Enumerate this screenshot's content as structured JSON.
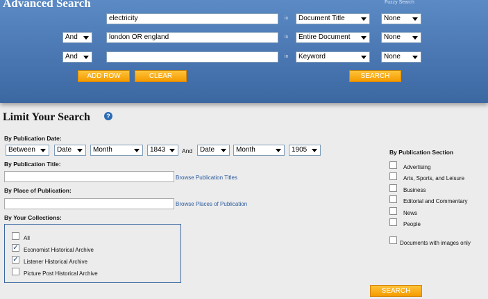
{
  "advanced_search": {
    "title": "Advanced Search",
    "fuzzy_label": "Fuzzy Search",
    "rows": [
      {
        "operator": "",
        "term": "electricity",
        "in_label": "in",
        "field": "Document Title",
        "fuzzy": "None"
      },
      {
        "operator": "And",
        "term": "london OR england",
        "in_label": "in",
        "field": "Entire Document",
        "fuzzy": "None"
      },
      {
        "operator": "And",
        "term": "",
        "in_label": "in",
        "field": "Keyword",
        "fuzzy": "None"
      }
    ],
    "add_row_label": "ADD ROW",
    "clear_label": "CLEAR",
    "search_label": "SEARCH"
  },
  "limit": {
    "title": "Limit Your Search",
    "help_icon": "?",
    "pub_date": {
      "label": "By Publication Date:",
      "mode": "Between",
      "from_unit": "Date",
      "from_month": "Month",
      "from_year": "1843",
      "and_label": "And",
      "to_unit": "Date",
      "to_month": "Month",
      "to_year": "1905"
    },
    "pub_title": {
      "label": "By Publication Title:",
      "value": "",
      "link": "Browse Publication Titles"
    },
    "pub_place": {
      "label": "By Place of Publication:",
      "value": "",
      "link": "Browse Places of Publication"
    },
    "collections": {
      "label": "By Your Collections:",
      "items": [
        {
          "label": "All",
          "checked": false
        },
        {
          "label": "Economist Historical Archive",
          "checked": true
        },
        {
          "label": "Listener Historical Archive",
          "checked": true
        },
        {
          "label": "Picture Post Historical Archive",
          "checked": false
        }
      ]
    },
    "sections": {
      "label": "By Publication Section",
      "items": [
        {
          "label": "Advertising",
          "checked": false
        },
        {
          "label": "Arts, Sports, and Leisure",
          "checked": false
        },
        {
          "label": "Business",
          "checked": false
        },
        {
          "label": "Editorial and Commentary",
          "checked": false
        },
        {
          "label": "News",
          "checked": false
        },
        {
          "label": "People",
          "checked": false
        }
      ],
      "images_only": {
        "label": "Documents with images only",
        "checked": false
      }
    },
    "search_label": "SEARCH"
  },
  "colors": {
    "header_blue": "#4d7ab5",
    "button_orange": "#f7a21b",
    "link_blue": "#2b5a9e"
  },
  "icons": {
    "dropdown": "chevron-down-icon",
    "help": "help-icon",
    "check": "checkmark-icon"
  }
}
